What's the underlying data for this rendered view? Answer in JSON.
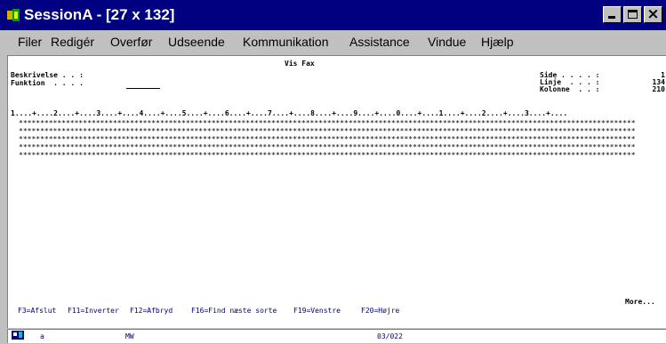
{
  "window": {
    "title": "SessionA - [27 x 132]"
  },
  "menu": {
    "items": [
      {
        "label": "Filer"
      },
      {
        "label": "Redigér"
      },
      {
        "label": "Overfør"
      },
      {
        "label": "Udseende"
      },
      {
        "label": "Kommunikation"
      },
      {
        "label": "Assistance"
      },
      {
        "label": "Vindue"
      },
      {
        "label": "Hjælp"
      }
    ]
  },
  "screen": {
    "heading": "Vis Fax",
    "labels": {
      "beskrivelse": "Beskrivelse . . :",
      "funktion": "Funktion  . . . ."
    },
    "info": {
      "side_label": "Side . . . . :",
      "side_value": "1",
      "linje_label": "Linje  . . . :",
      "linje_value": "134",
      "kolonne_label": "Kolonne  . . :",
      "kolonne_value": "210"
    },
    "ruler": "1....+....2....+....3....+....4....+....5....+....6....+....7....+....8....+....9....+....0....+....1....+....2....+....3....+....",
    "star_rows": [
      "************************************************************************************************************************************************",
      "************************************************************************************************************************************************",
      "************************************************************************************************************************************************",
      "************************************************************************************************************************************************",
      "************************************************************************************************************************************************"
    ],
    "more": "More...",
    "fkeys": [
      {
        "label": "F3=Afslut"
      },
      {
        "label": "F11=Inverter"
      },
      {
        "label": "F12=Afbryd"
      },
      {
        "label": "F16=Find næste sorte"
      },
      {
        "label": "F19=Venstre"
      },
      {
        "label": "F20=Højre"
      }
    ]
  },
  "status": {
    "mode": "a",
    "indicator": "MW",
    "cursor": "03/022"
  }
}
